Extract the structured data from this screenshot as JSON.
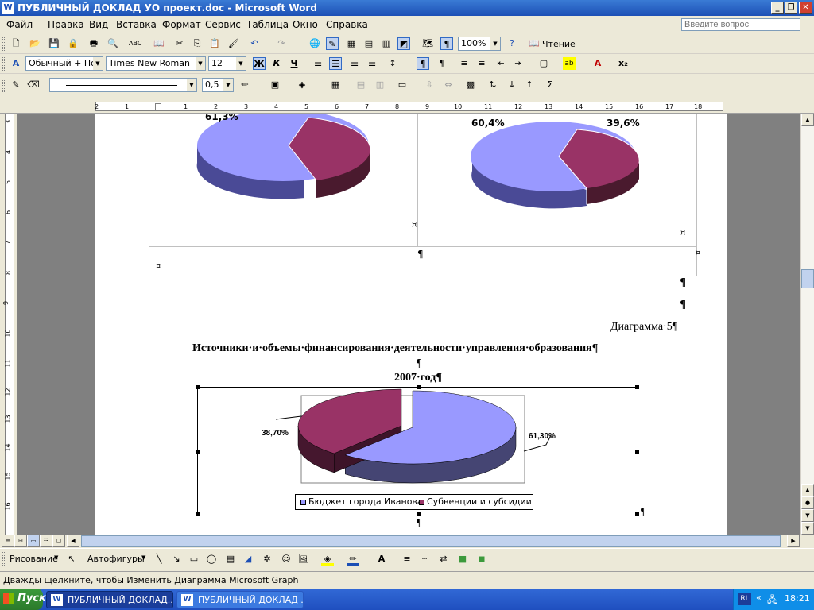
{
  "window": {
    "title": "ПУБЛИЧНЫЙ ДОКЛАД УО проект.doc - Microsoft Word",
    "icon_letter": "W",
    "minimize_glyph": "_",
    "restore_glyph": "❐",
    "close_glyph": "✕"
  },
  "menu": {
    "items": [
      "Файл",
      "Правка",
      "Вид",
      "Вставка",
      "Формат",
      "Сервис",
      "Таблица",
      "Окно",
      "Справка"
    ],
    "help_placeholder": "Введите вопрос",
    "close_doc_glyph": "✕"
  },
  "toolbar_standard": {
    "zoom": "100%",
    "reading_label": "Чтение"
  },
  "toolbar_format": {
    "style": "Обычный + По ц",
    "font": "Times New Roman",
    "size": "12",
    "bold": "Ж",
    "italic": "К",
    "underline": "Ч",
    "subscript": "x₂"
  },
  "toolbar_tables": {
    "line_weight": "0,5",
    "sigma": "Σ"
  },
  "ruler": {
    "h_numbers": [
      "2",
      "1",
      "1",
      "2",
      "3",
      "4",
      "5",
      "6",
      "7",
      "8",
      "9",
      "10",
      "11",
      "12",
      "13",
      "14",
      "15",
      "16",
      "17",
      "18"
    ],
    "v_numbers": [
      "3",
      "4",
      "5",
      "6",
      "7",
      "8",
      "9",
      "10",
      "11",
      "12",
      "13",
      "14",
      "15",
      "16"
    ]
  },
  "document": {
    "upper_left_pct": "61,3%",
    "upper_right_pct_a": "60,4%",
    "upper_right_pct_b": "39,6%",
    "cell_marker": "¤",
    "para_mark": "¶",
    "caption": "Диаграмма·5¶",
    "heading": "Источники·и·объемы·финансирования·деятельности·управления·образования¶",
    "year": "2007·год¶"
  },
  "chart_data": {
    "type": "pie",
    "title": "",
    "categories": [
      "Бюджет города Иванова",
      "Субвенции и субсидии"
    ],
    "values": [
      61.3,
      38.7
    ],
    "labels": [
      "61,30%",
      "38,70%"
    ],
    "colors": [
      "#9999ff",
      "#993366"
    ],
    "legend_position": "bottom"
  },
  "draw_toolbar": {
    "drawing_label": "Рисование",
    "autoshapes_label": "Автофигуры"
  },
  "status": {
    "text": "Дважды щелкните, чтобы Изменить Диаграмма Microsoft Graph"
  },
  "taskbar": {
    "start_label": "Пуск",
    "task1": "ПУБЛИЧНЫЙ ДОКЛАД...",
    "task2": "ПУБЛИЧНЫЙ ДОКЛАД ...",
    "lang": "RL",
    "time": "18:21"
  }
}
